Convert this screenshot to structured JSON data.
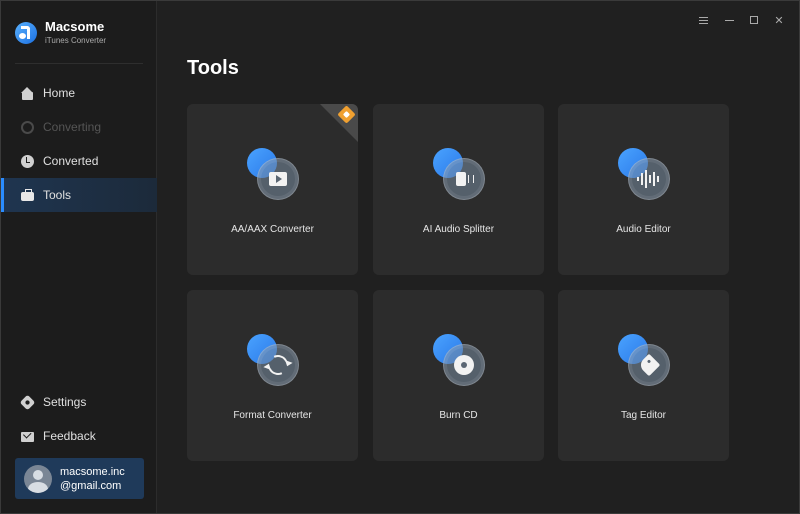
{
  "app": {
    "name": "Macsome",
    "subtitle": "iTunes Converter"
  },
  "sidebar": {
    "items": [
      {
        "label": "Home",
        "icon": "home-icon",
        "state": "normal"
      },
      {
        "label": "Converting",
        "icon": "converting-icon",
        "state": "disabled"
      },
      {
        "label": "Converted",
        "icon": "converted-icon",
        "state": "normal"
      },
      {
        "label": "Tools",
        "icon": "tools-icon",
        "state": "active"
      }
    ],
    "bottom_items": [
      {
        "label": "Settings",
        "icon": "settings-icon"
      },
      {
        "label": "Feedback",
        "icon": "feedback-icon"
      }
    ],
    "account": {
      "email_line1": "macsome.inc",
      "email_line2": "@gmail.com"
    }
  },
  "window_controls": [
    "menu-icon",
    "minimize-icon",
    "maximize-icon",
    "close-icon"
  ],
  "main": {
    "title": "Tools",
    "tools": [
      {
        "label": "AA/AAX Converter",
        "icon": "play-video-icon",
        "badge": true
      },
      {
        "label": "AI Audio Splitter",
        "icon": "audio-split-icon"
      },
      {
        "label": "Audio Editor",
        "icon": "waveform-icon"
      },
      {
        "label": "Format Converter",
        "icon": "convert-arrows-icon"
      },
      {
        "label": "Burn CD",
        "icon": "cd-icon"
      },
      {
        "label": "Tag Editor",
        "icon": "tag-icon"
      }
    ]
  },
  "colors": {
    "accent": "#2a8cff",
    "active_bg": "#1f3550",
    "card_bg": "#2c2c2c",
    "badge": "#f0a030"
  }
}
